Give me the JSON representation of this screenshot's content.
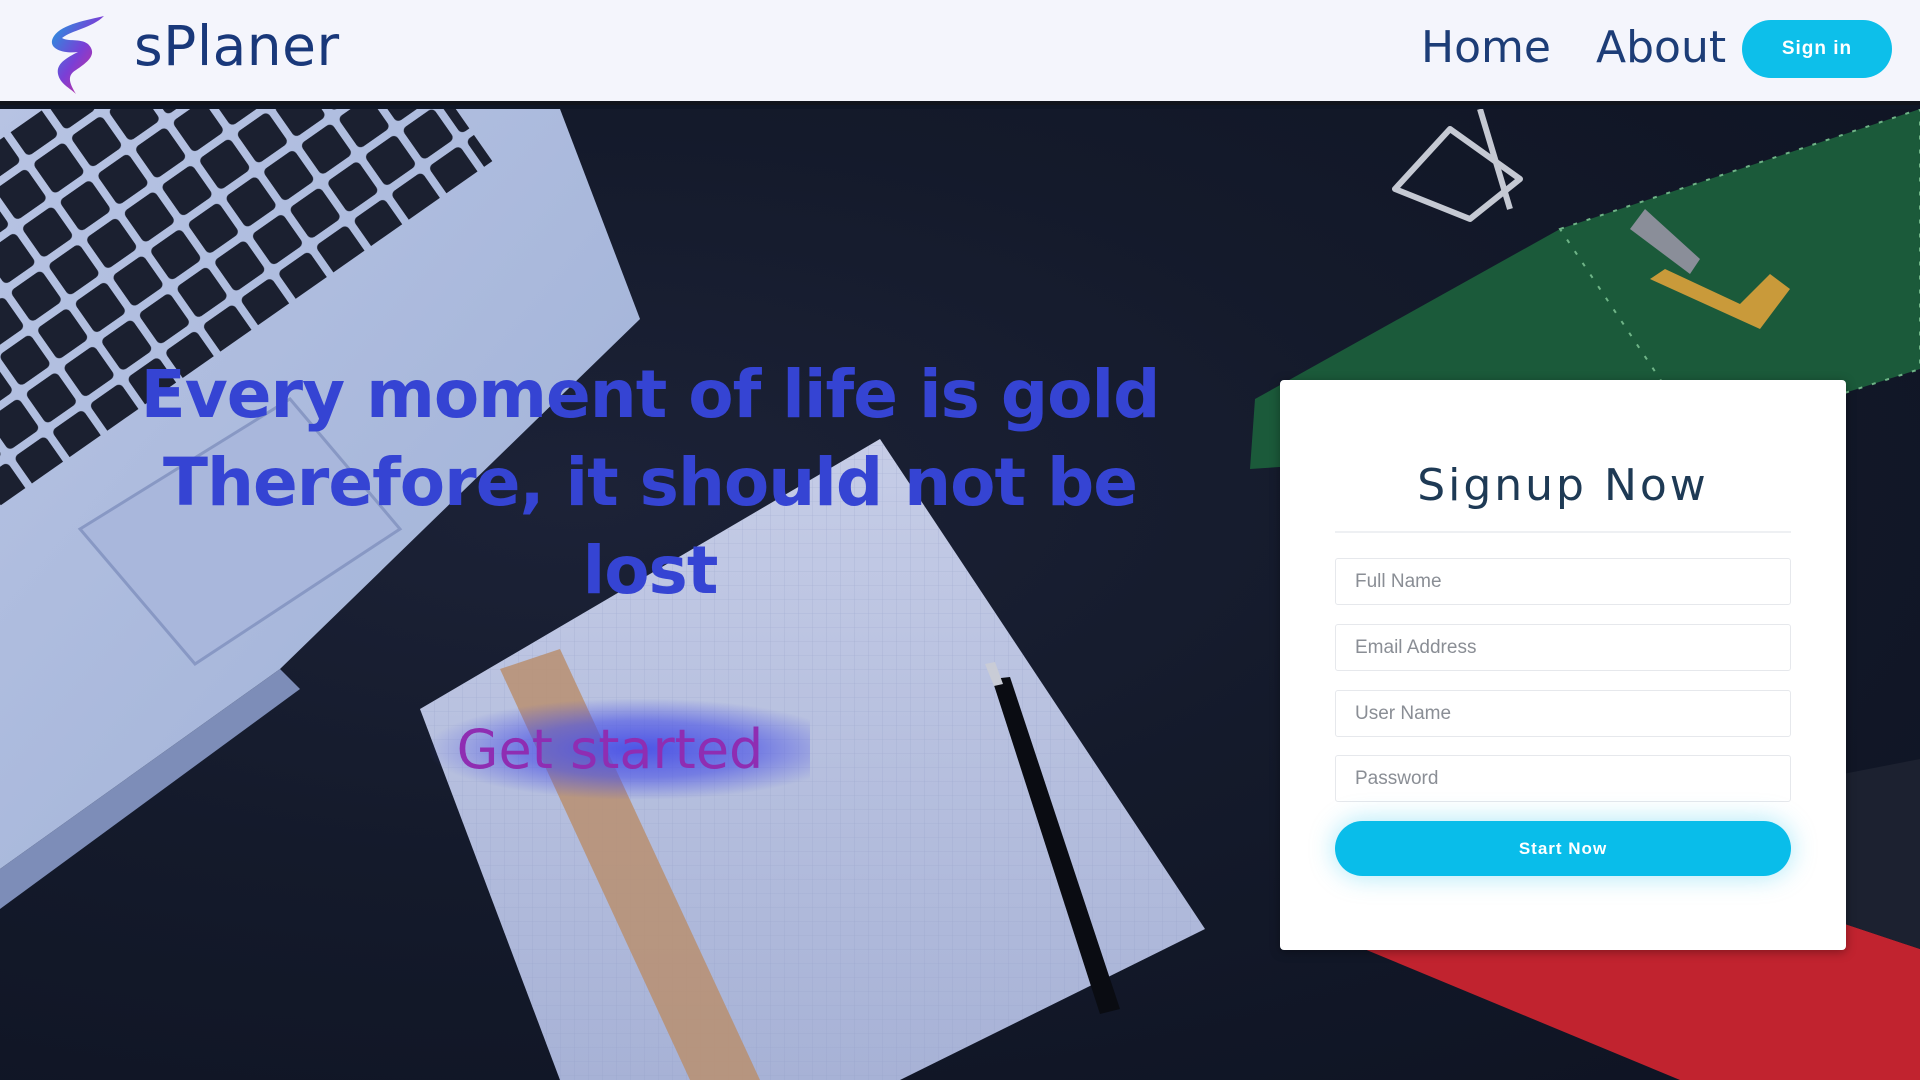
{
  "header": {
    "brand": "sPlaner",
    "nav": {
      "home": "Home",
      "about": "About"
    },
    "signin_label": "Sign in",
    "logo_icon": "splaner-logo-icon"
  },
  "hero": {
    "title_line1": "Every moment of life is gold",
    "title_line2": "Therefore, it should not be lost",
    "cta_label": "Get started"
  },
  "signup": {
    "title": "Signup Now",
    "fields": [
      {
        "placeholder": "Full Name",
        "value": ""
      },
      {
        "placeholder": "Email Address",
        "value": ""
      },
      {
        "placeholder": "User Name",
        "value": ""
      },
      {
        "placeholder": "Password",
        "value": ""
      }
    ],
    "submit_label": "Start Now"
  },
  "colors": {
    "accent": "#0dbfea",
    "brand_text": "#19387a",
    "hero_text": "#3544d3",
    "cta_text": "#8f2db2",
    "header_bg": "#f4f5fc"
  }
}
